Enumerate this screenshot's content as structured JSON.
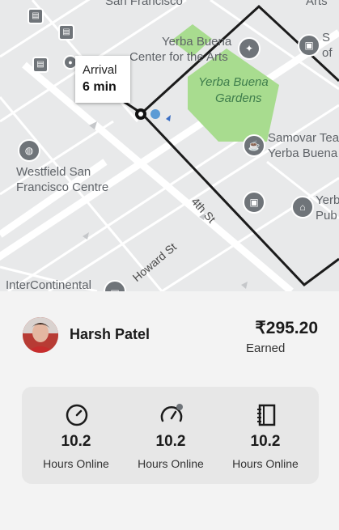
{
  "map": {
    "labels": {
      "top_street": "San Francisco",
      "top_right": "Arts",
      "yerba_buena_center_line1": "Yerba Buena",
      "yerba_buena_center_line2": "Center for the Arts",
      "gardens_line1": "Yerba Buena",
      "gardens_line2": "Gardens",
      "samovar_line1": "Samovar Tea",
      "samovar_line2": "Yerba Buena",
      "westfield_line1": "Westfield San",
      "westfield_line2": "Francisco Centre",
      "fourth_st": "4th St",
      "yerba_pub_line1": "Yerb",
      "yerba_pub_line2": "Pub",
      "howard_st": "Howard St",
      "intercontinental": "InterContinental",
      "right_edge_top": "S",
      "right_edge_bottom": "of"
    },
    "arrival_title": "Arrival",
    "arrival_time": "6 min",
    "route_color": "#1b1b1b",
    "park_color": "#a8dc8f"
  },
  "driver": {
    "name": "Harsh Patel",
    "earnings": "₹295.20",
    "earnings_label": "Earned"
  },
  "stats": [
    {
      "icon": "clock-icon",
      "value": "10.2",
      "label": "Hours Online"
    },
    {
      "icon": "speedometer-icon",
      "value": "10.2",
      "label": "Hours Online"
    },
    {
      "icon": "notebook-icon",
      "value": "10.2",
      "label": "Hours Online"
    }
  ]
}
